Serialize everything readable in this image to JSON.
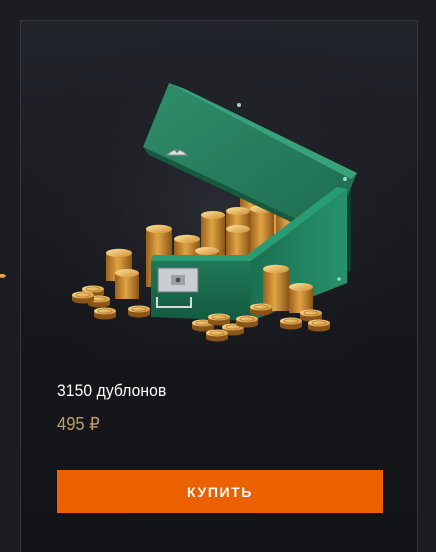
{
  "product": {
    "title": "3150 дублонов",
    "price": "495 ₽",
    "image_icon": "gold-coins-chest-icon"
  },
  "actions": {
    "buy_label": "КУПИТЬ"
  },
  "colors": {
    "accent": "#eb6100",
    "price": "#c29c6c",
    "background": "#1b1d22"
  }
}
